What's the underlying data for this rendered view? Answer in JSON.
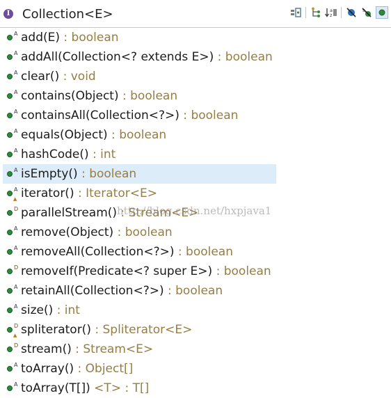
{
  "header": {
    "type_letter": "I",
    "title": "Collection<E>"
  },
  "toolbar": [
    {
      "icon": "fields-icon"
    },
    {
      "icon": "hierarchy-icon"
    },
    {
      "icon": "sort-icon"
    },
    {
      "icon": "hide-fields-icon"
    },
    {
      "icon": "hide-static-icon"
    },
    {
      "icon": "public-members-icon"
    }
  ],
  "methods": [
    {
      "name": "add(E)",
      "ret": " : boolean",
      "mod": "A"
    },
    {
      "name": "addAll(Collection<? extends E>)",
      "ret": " : boolean",
      "mod": "A"
    },
    {
      "name": "clear()",
      "ret": " : void",
      "mod": "A"
    },
    {
      "name": "contains(Object)",
      "ret": " : boolean",
      "mod": "A"
    },
    {
      "name": "containsAll(Collection<?>)",
      "ret": " : boolean",
      "mod": "A"
    },
    {
      "name": "equals(Object)",
      "ret": " : boolean",
      "mod": "A"
    },
    {
      "name": "hashCode()",
      "ret": " : int",
      "mod": "A"
    },
    {
      "name": "isEmpty()",
      "ret": " : boolean",
      "mod": "A",
      "selected": true
    },
    {
      "name": "iterator()",
      "ret": " : Iterator<E>",
      "mod": "A",
      "override": true
    },
    {
      "name": "parallelStream()",
      "ret": " : Stream<E>",
      "mod": "D"
    },
    {
      "name": "remove(Object)",
      "ret": " : boolean",
      "mod": "A"
    },
    {
      "name": "removeAll(Collection<?>)",
      "ret": " : boolean",
      "mod": "A"
    },
    {
      "name": "removeIf(Predicate<? super E>)",
      "ret": " : boolean",
      "mod": "D"
    },
    {
      "name": "retainAll(Collection<?>)",
      "ret": " : boolean",
      "mod": "A"
    },
    {
      "name": "size()",
      "ret": " : int",
      "mod": "A"
    },
    {
      "name": "spliterator()",
      "ret": " : Spliterator<E>",
      "mod": "D",
      "override": true
    },
    {
      "name": "stream()",
      "ret": " : Stream<E>",
      "mod": "D"
    },
    {
      "name": "toArray()",
      "ret": " : Object[]",
      "mod": "A"
    },
    {
      "name": "toArray(T[])",
      "ret": " <T> : T[]",
      "mod": "A"
    }
  ],
  "watermark": "http://blog.csdn.net/hxpjava1"
}
